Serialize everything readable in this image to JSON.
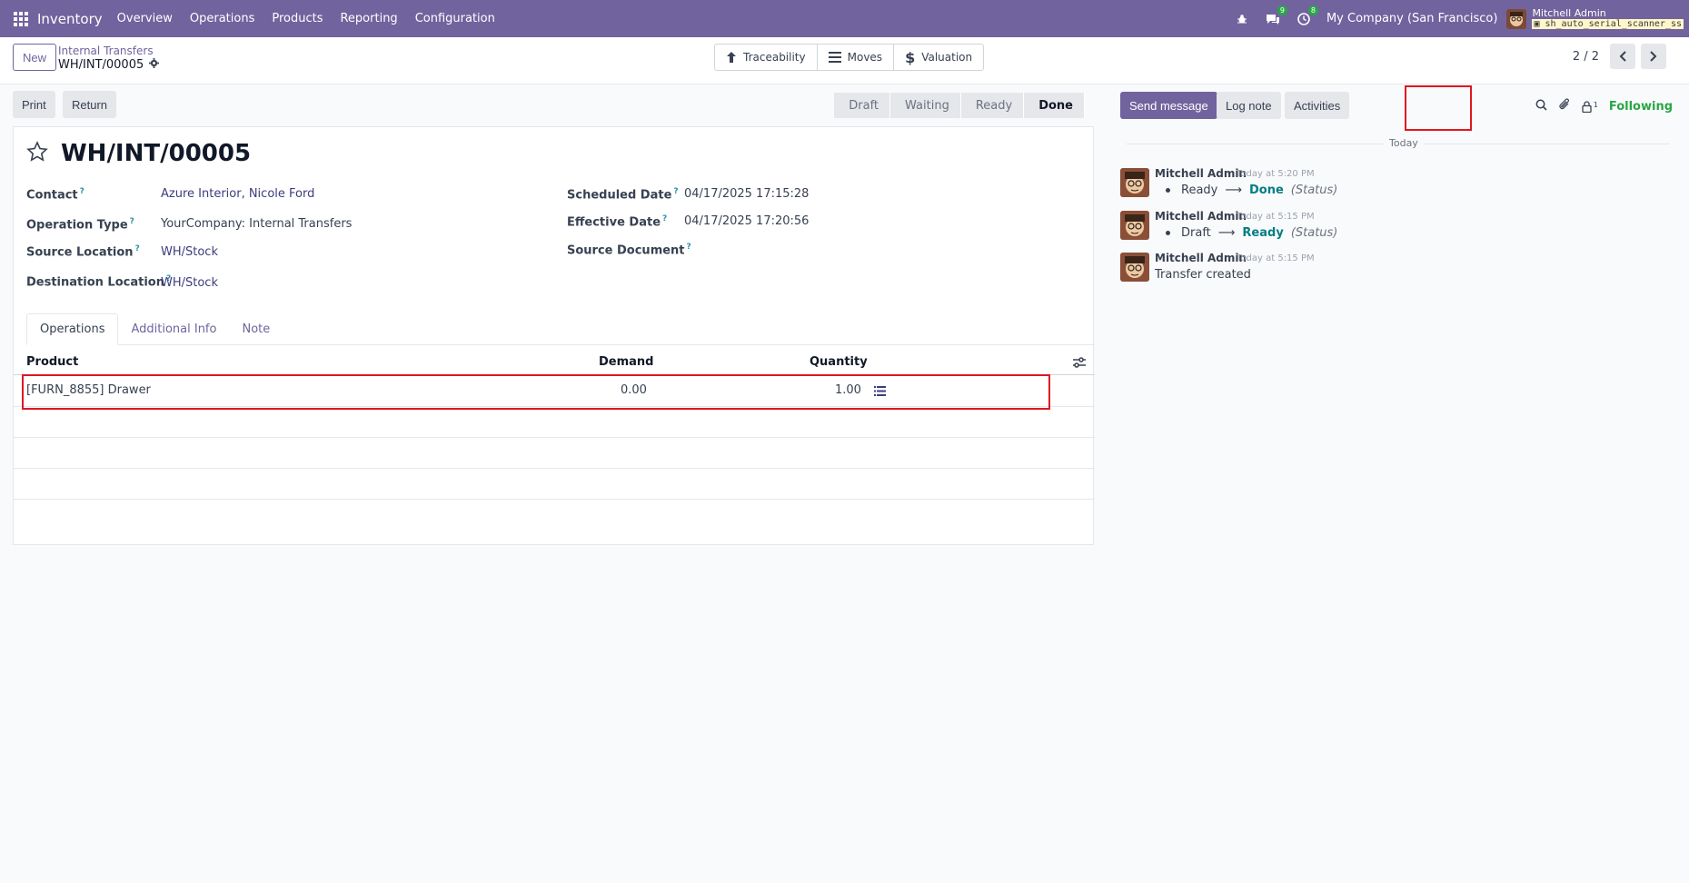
{
  "navbar": {
    "app_name": "Inventory",
    "menu": [
      "Overview",
      "Operations",
      "Products",
      "Reporting",
      "Configuration"
    ],
    "messages_count": "9",
    "activities_count": "8",
    "company": "My Company (San Francisco)",
    "user_name": "Mitchell Admin",
    "database": "sh_auto_serial_scanner_ss",
    "accent_color": "#71639e"
  },
  "control": {
    "new_label": "New",
    "breadcrumb_parent": "Internal Transfers",
    "breadcrumb_current": "WH/INT/00005",
    "smart_buttons": [
      "Traceability",
      "Moves",
      "Valuation"
    ],
    "pager": "2 / 2"
  },
  "form": {
    "print_label": "Print",
    "return_label": "Return",
    "stages": [
      "Draft",
      "Waiting",
      "Ready",
      "Done"
    ],
    "current_stage": "Done",
    "title": "WH/INT/00005",
    "fields": {
      "contact_label": "Contact",
      "contact_value": "Azure Interior, Nicole Ford",
      "operation_type_label": "Operation Type",
      "operation_type_value": "YourCompany: Internal Transfers",
      "source_location_label": "Source Location",
      "source_location_value": "WH/Stock",
      "destination_location_label": "Destination Location",
      "destination_location_value": "WH/Stock",
      "scheduled_date_label": "Scheduled Date",
      "scheduled_date_value": "04/17/2025 17:15:28",
      "effective_date_label": "Effective Date",
      "effective_date_value": "04/17/2025 17:20:56",
      "source_document_label": "Source Document",
      "source_document_value": ""
    },
    "tabs": [
      "Operations",
      "Additional Info",
      "Note"
    ],
    "table": {
      "columns": [
        "Product",
        "Demand",
        "Quantity"
      ],
      "rows": [
        {
          "product": "[FURN_8855] Drawer",
          "demand": "0.00",
          "quantity": "1.00"
        }
      ]
    }
  },
  "chatter": {
    "send_message": "Send message",
    "log_note": "Log note",
    "activities": "Activities",
    "followers_count": "1",
    "following": "Following",
    "date_separator": "Today",
    "messages": [
      {
        "author": "Mitchell Admin",
        "time": "Today at 5:20 PM",
        "from": "Ready",
        "to": "Done",
        "field": "(Status)"
      },
      {
        "author": "Mitchell Admin",
        "time": "Today at 5:15 PM",
        "from": "Draft",
        "to": "Ready",
        "field": "(Status)"
      },
      {
        "author": "Mitchell Admin",
        "time": "Today at 5:15 PM",
        "text": "Transfer created"
      }
    ]
  }
}
